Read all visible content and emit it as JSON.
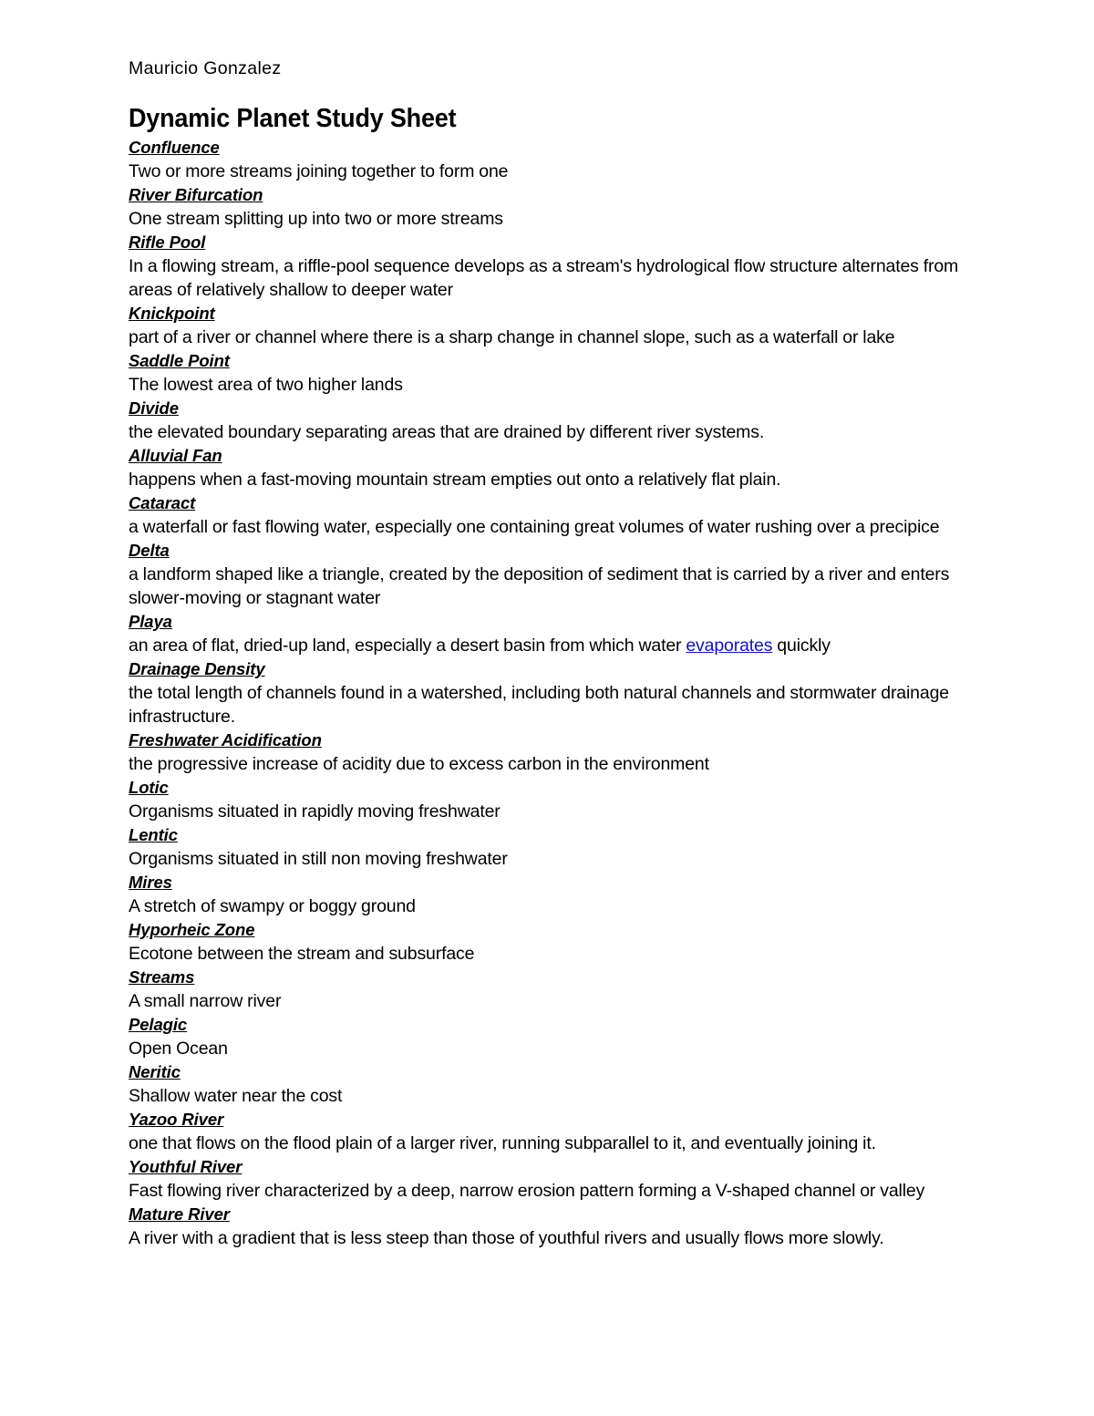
{
  "document": {
    "author": "Mauricio Gonzalez",
    "title": "Dynamic Planet Study Sheet",
    "link_color": "#1111CC",
    "text_color": "#000000",
    "page_background": "#FFFFFF",
    "entries": [
      {
        "term": "Confluence",
        "definition": "Two or more streams joining together to form one"
      },
      {
        "term": "River Bifurcation",
        "definition": "One stream splitting up into two or more streams"
      },
      {
        "term": "Rifle Pool",
        "definition": "In a flowing stream, a riffle-pool sequence develops as a stream's hydrological flow structure alternates from areas of relatively shallow to deeper water"
      },
      {
        "term": "Knickpoint",
        "definition": "part of a river or channel where there is a sharp change in channel slope, such as a waterfall or lake"
      },
      {
        "term": "Saddle Point",
        "definition": "The lowest area of two higher lands"
      },
      {
        "term": "Divide",
        "definition": "the elevated boundary separating areas that are drained by different river systems."
      },
      {
        "term": "Alluvial Fan",
        "definition": "happens when a fast-moving mountain stream empties out onto a relatively flat plain."
      },
      {
        "term": "Cataract",
        "definition": "a waterfall or fast flowing water, especially one containing great volumes of water rushing over a precipice"
      },
      {
        "term": "Delta",
        "definition": "a landform shaped like a triangle, created by the deposition of sediment that is carried by a river and enters slower-moving or stagnant water"
      },
      {
        "term": "Playa",
        "definition_before_link": "an area of flat, dried-up land, especially a desert basin from which water ",
        "definition_link": "evaporates",
        "definition_after_link": " quickly",
        "has_link": true
      },
      {
        "term": "Drainage Density",
        "definition": "the total length of channels found in a watershed, including both natural channels and stormwater drainage infrastructure."
      },
      {
        "term": "Freshwater Acidification",
        "definition": "the progressive increase of acidity due to excess carbon in the environment"
      },
      {
        "term": "Lotic",
        "definition": "Organisms situated in rapidly moving freshwater"
      },
      {
        "term": "Lentic",
        "definition": "Organisms situated in still non moving freshwater"
      },
      {
        "term": "Mires",
        "definition": "A stretch of swampy or boggy ground"
      },
      {
        "term": "Hyporheic Zone",
        "definition": "Ecotone between the stream and subsurface"
      },
      {
        "term": "Streams",
        "definition": "A small narrow river"
      },
      {
        "term": "Pelagic",
        "definition": "Open Ocean"
      },
      {
        "term": "Neritic",
        "definition": "Shallow water near the cost"
      },
      {
        "term": "Yazoo River",
        "definition": "one that flows on the flood plain of a larger river, running subparallel to it, and eventually joining it."
      },
      {
        "term": "Youthful River",
        "definition": "Fast flowing river characterized by a deep, narrow erosion pattern forming a V-shaped channel or valley"
      },
      {
        "term": "Mature River",
        "definition": "A river with a gradient that is less steep than those of youthful rivers and usually flows more slowly."
      }
    ]
  }
}
